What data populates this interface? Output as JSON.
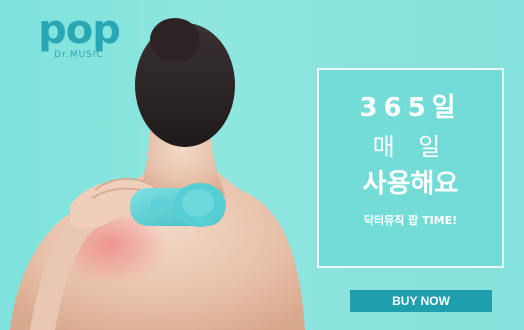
{
  "logo": {
    "word": "pop",
    "sub": "Dr.MUSIC"
  },
  "headline": {
    "line1": "365일",
    "line2": "매 일",
    "line3": "사용해요",
    "tagline": "닥터뮤직 팝 TIME!"
  },
  "cta": {
    "label": "BUY NOW"
  },
  "colors": {
    "background": "#8ee6df",
    "brand": "#2aa7b4",
    "button": "#1f9eae",
    "device": "#55cfd4"
  }
}
